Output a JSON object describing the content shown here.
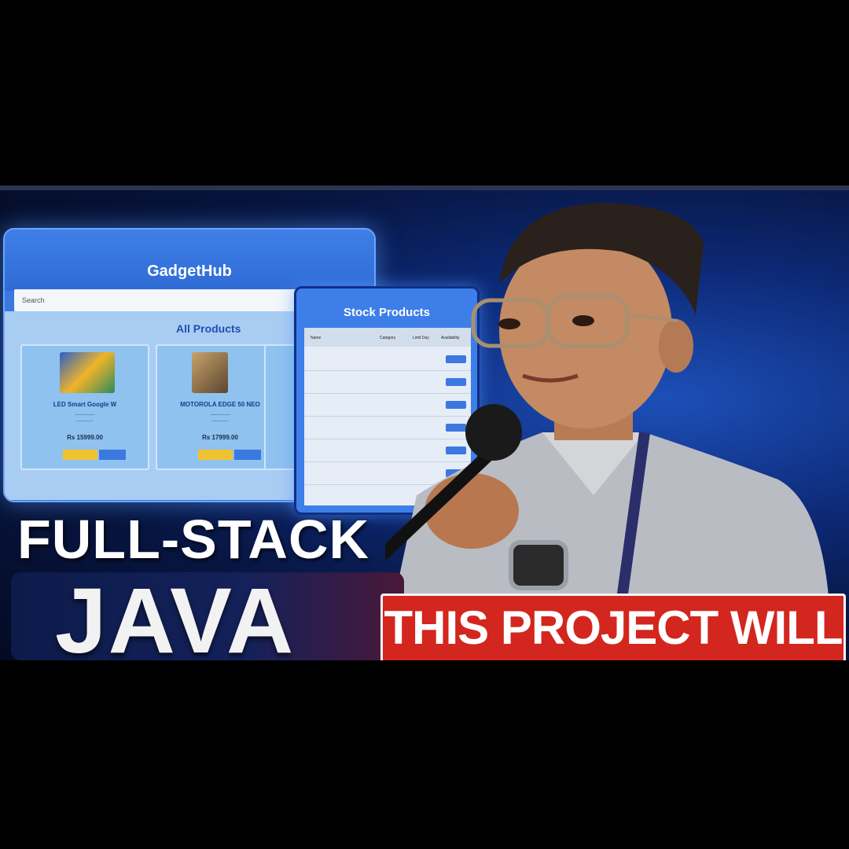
{
  "gadget_hub": {
    "title": "GadgetHub",
    "search_placeholder": "Search",
    "section_title": "All Products",
    "products": [
      {
        "name": "LED Smart Google W",
        "price": "Rs 15999.00",
        "color": "#3a6fd0"
      },
      {
        "name": "MOTOROLA EDGE 50 NEO",
        "price": "Rs 17999.00",
        "color": "#8a6b4a"
      }
    ]
  },
  "stock_products": {
    "title": "Stock Products",
    "headers": [
      "Name",
      "Category",
      "Limit Day",
      "Availability"
    ]
  },
  "headline": {
    "line1": "FULL-STACK",
    "line2": "JAVA"
  },
  "banner": {
    "text": "THIS PROJECT WILL"
  },
  "colors": {
    "banner_red": "#d3261e",
    "accent_blue": "#3b78e0"
  }
}
